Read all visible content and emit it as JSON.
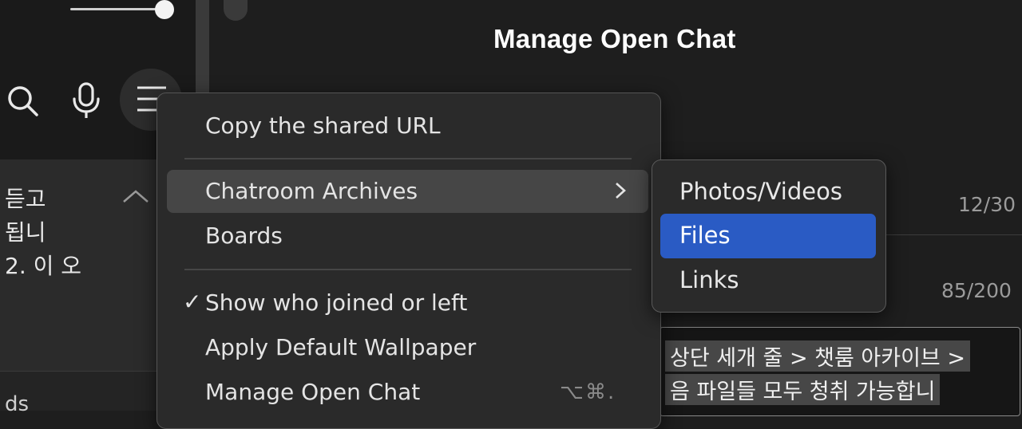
{
  "header": {
    "title": "Manage Open Chat"
  },
  "left": {
    "chat_preview_lines": [
      "듣고",
      "됩니",
      "2. 이 오"
    ],
    "bottom_partial": "ds"
  },
  "counters": {
    "first": "12/30",
    "second": "85/200"
  },
  "description_box": {
    "lines": [
      "상단 세개 줄 > 챗룸 아카이브 >",
      "음 파일들 모두 청취 가능합니"
    ]
  },
  "context_menu": {
    "items": [
      {
        "label": "Copy the shared URL"
      },
      {
        "label": "Chatroom Archives"
      },
      {
        "label": "Boards"
      },
      {
        "label": "Show who joined or left",
        "checked": true
      },
      {
        "label": "Apply Default Wallpaper"
      },
      {
        "label": "Manage Open Chat",
        "shortcut": "⌥⌘."
      }
    ]
  },
  "submenu": {
    "items": [
      {
        "label": "Photos/Videos"
      },
      {
        "label": "Files",
        "selected": true
      },
      {
        "label": "Links"
      }
    ]
  },
  "colors": {
    "selection": "#2a5bc4",
    "background": "#1e1e1e",
    "menu_bg": "#2a2a2a"
  },
  "icons": [
    "search-icon",
    "microphone-icon",
    "hamburger-menu-icon",
    "chevron-up-icon",
    "chevron-right-icon",
    "checkmark-icon"
  ]
}
